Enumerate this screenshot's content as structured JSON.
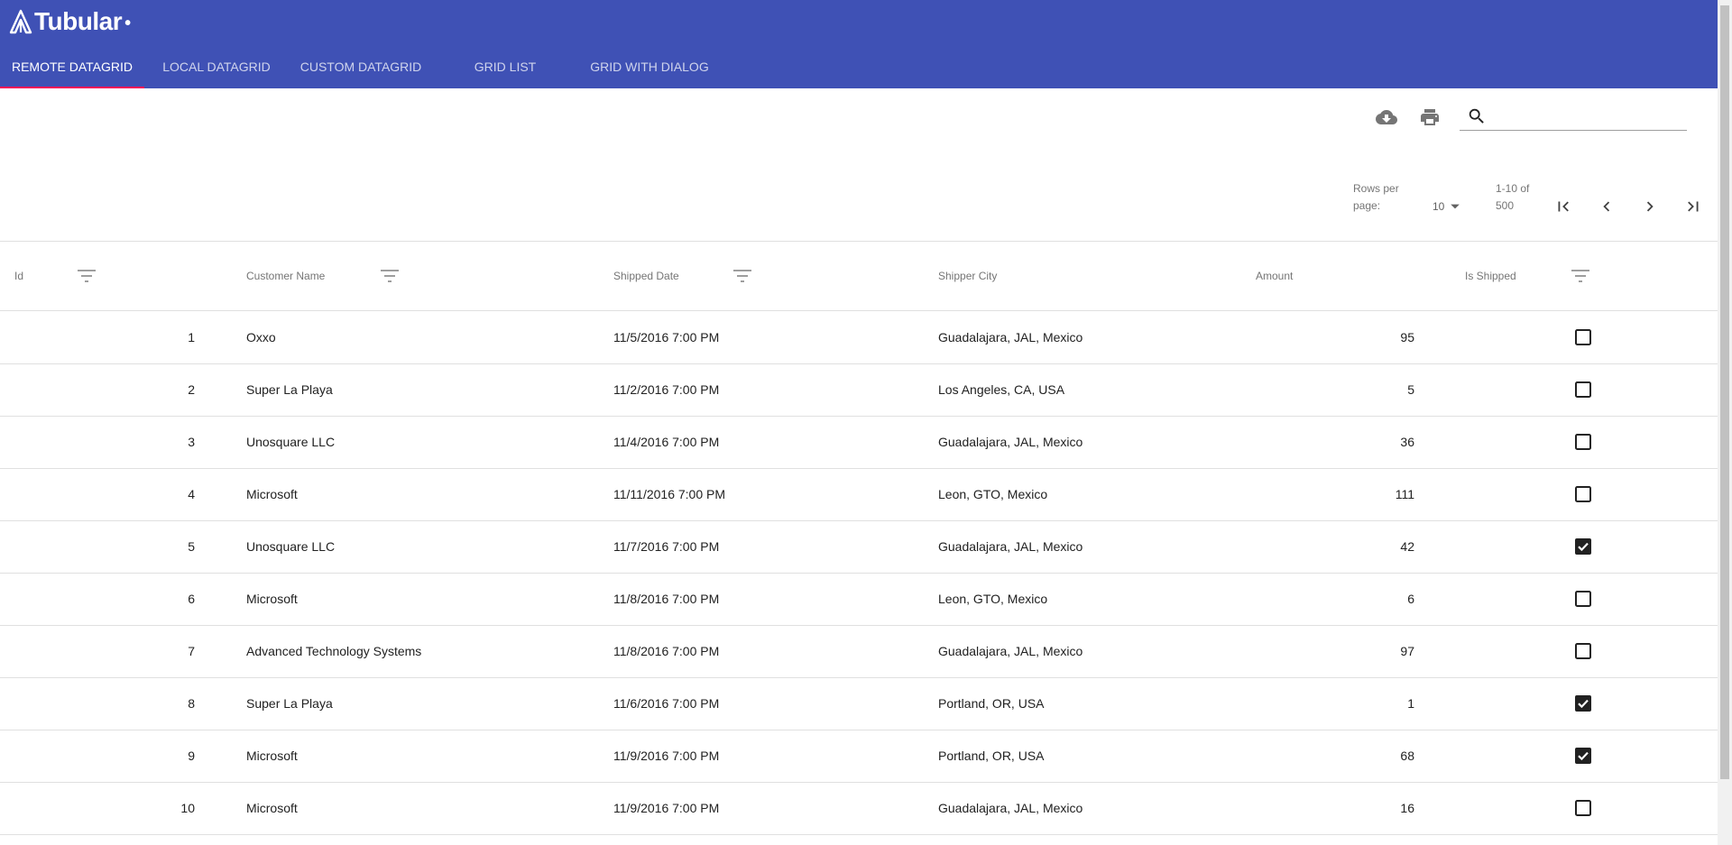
{
  "app": {
    "logo_text": "Tubular",
    "logo_dot": "•"
  },
  "tabs": [
    {
      "label": "Remote Datagrid",
      "active": true
    },
    {
      "label": "Local Datagrid",
      "active": false
    },
    {
      "label": "Custom Datagrid",
      "active": false
    },
    {
      "label": "Grid List",
      "active": false
    },
    {
      "label": "Grid with Dialog",
      "active": false
    }
  ],
  "toolbar": {
    "icons": [
      "cloud-download-icon",
      "print-icon",
      "search-icon"
    ],
    "search_value": ""
  },
  "pagination": {
    "rows_per_page_label_line1": "Rows per",
    "rows_per_page_label_line2": "page:",
    "rows_per_page_value": "10",
    "range_line1": "1-10 of",
    "range_line2": "500"
  },
  "columns": {
    "id": "Id",
    "customer": "Customer Name",
    "date": "Shipped Date",
    "city": "Shipper City",
    "amount": "Amount",
    "shipped": "Is Shipped"
  },
  "rows": [
    {
      "id": "1",
      "customer": "Oxxo",
      "date": "11/5/2016 7:00 PM",
      "city": "Guadalajara, JAL, Mexico",
      "amount": "95",
      "shipped": false
    },
    {
      "id": "2",
      "customer": "Super La Playa",
      "date": "11/2/2016 7:00 PM",
      "city": "Los Angeles, CA, USA",
      "amount": "5",
      "shipped": false
    },
    {
      "id": "3",
      "customer": "Unosquare LLC",
      "date": "11/4/2016 7:00 PM",
      "city": "Guadalajara, JAL, Mexico",
      "amount": "36",
      "shipped": false
    },
    {
      "id": "4",
      "customer": "Microsoft",
      "date": "11/11/2016 7:00 PM",
      "city": "Leon, GTO, Mexico",
      "amount": "111",
      "shipped": false
    },
    {
      "id": "5",
      "customer": "Unosquare LLC",
      "date": "11/7/2016 7:00 PM",
      "city": "Guadalajara, JAL, Mexico",
      "amount": "42",
      "shipped": true
    },
    {
      "id": "6",
      "customer": "Microsoft",
      "date": "11/8/2016 7:00 PM",
      "city": "Leon, GTO, Mexico",
      "amount": "6",
      "shipped": false
    },
    {
      "id": "7",
      "customer": "Advanced Technology Systems",
      "date": "11/8/2016 7:00 PM",
      "city": "Guadalajara, JAL, Mexico",
      "amount": "97",
      "shipped": false
    },
    {
      "id": "8",
      "customer": "Super La Playa",
      "date": "11/6/2016 7:00 PM",
      "city": "Portland, OR, USA",
      "amount": "1",
      "shipped": true
    },
    {
      "id": "9",
      "customer": "Microsoft",
      "date": "11/9/2016 7:00 PM",
      "city": "Portland, OR, USA",
      "amount": "68",
      "shipped": true
    },
    {
      "id": "10",
      "customer": "Microsoft",
      "date": "11/9/2016 7:00 PM",
      "city": "Guadalajara, JAL, Mexico",
      "amount": "16",
      "shipped": false
    }
  ],
  "colors": {
    "primary": "#3f51b5",
    "accent": "#f50057",
    "divider": "#e0e0e0"
  }
}
